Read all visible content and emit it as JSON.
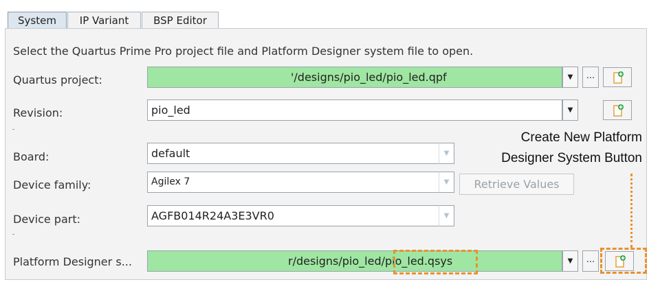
{
  "tabs": [
    {
      "label": "System",
      "active": true
    },
    {
      "label": "IP Variant",
      "active": false
    },
    {
      "label": "BSP Editor",
      "active": false
    }
  ],
  "instructions": "Select the Quartus Prime Pro project file and Platform Designer system file to open.",
  "quartus_project": {
    "label": "Quartus project:",
    "value": "'/designs/pio_led/pio_led.qpf"
  },
  "revision": {
    "label": "Revision:",
    "value": "pio_led"
  },
  "board": {
    "label": "Board:",
    "value": "default"
  },
  "device_family": {
    "label": "Device family:",
    "value": "Agilex 7"
  },
  "device_part": {
    "label": "Device part:",
    "value": "AGFB014R24A3E3VR0"
  },
  "retrieve_values": "Retrieve Values",
  "platform_designer": {
    "label": "Platform Designer s...",
    "value_prefix": "r/designs/pio_led/",
    "value_highlight": "pio_led.qsys"
  },
  "browse_label": "...",
  "dropdown_glyph": "▼",
  "callout": {
    "line1": "Create New Platform",
    "line2": "Designer System Button"
  },
  "colors": {
    "field_green": "#9fe6a2",
    "highlight_orange": "#e8912f",
    "new_icon_green": "#2da84a"
  },
  "icons": [
    "new-file-icon",
    "dropdown-arrow-icon",
    "browse-ellipsis-icon"
  ]
}
